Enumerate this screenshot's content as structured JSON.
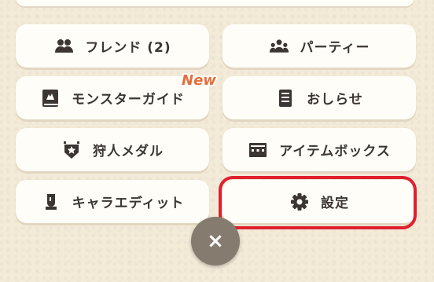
{
  "menu": {
    "friend_label": "フレンド (2)",
    "party_label": "パーティー",
    "monster_guide_label": "モンスターガイド",
    "notice_label": "おしらせ",
    "hunter_medal_label": "狩人メダル",
    "item_box_label": "アイテムボックス",
    "chara_edit_label": "キャラエディット",
    "settings_label": "設定"
  },
  "badges": {
    "new_label": "New"
  },
  "icons": {
    "friend": "friends-icon",
    "party": "party-icon",
    "monster_guide": "monster-guide-book-icon",
    "notice": "notice-list-icon",
    "hunter_medal": "medal-icon",
    "item_box": "item-box-icon",
    "chara_edit": "character-head-icon",
    "settings": "gear-icon",
    "close": "close-icon"
  },
  "close_button": {
    "glyph": "×"
  },
  "colors": {
    "background": "#f3ead8",
    "button": "#fffdf8",
    "text": "#3b3633",
    "new_badge": "#e36f3a",
    "highlight": "#e0202e",
    "close_button": "#857c6f"
  }
}
